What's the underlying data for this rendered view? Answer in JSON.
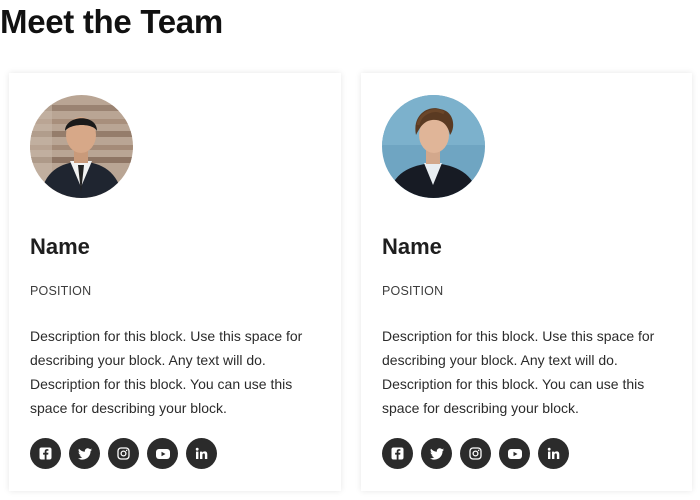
{
  "page": {
    "title": "Meet the Team"
  },
  "colors": {
    "social_button_bg": "#2b2b2b",
    "card_bg": "#ffffff"
  },
  "members": [
    {
      "name": "Name",
      "position": "POSITION",
      "description": "Description for this block. Use this space for describing your block. Any text will do. Description for this block. You can use this space for describing your block.",
      "avatar_icon": "person-photo-icon",
      "social": [
        "facebook-icon",
        "twitter-icon",
        "instagram-icon",
        "youtube-icon",
        "linkedin-icon"
      ]
    },
    {
      "name": "Name",
      "position": "POSITION",
      "description": "Description for this block. Use this space for describing your block. Any text will do. Description for this block. You can use this space for describing your block.",
      "avatar_icon": "person-photo-icon",
      "social": [
        "facebook-icon",
        "twitter-icon",
        "instagram-icon",
        "youtube-icon",
        "linkedin-icon"
      ]
    }
  ]
}
